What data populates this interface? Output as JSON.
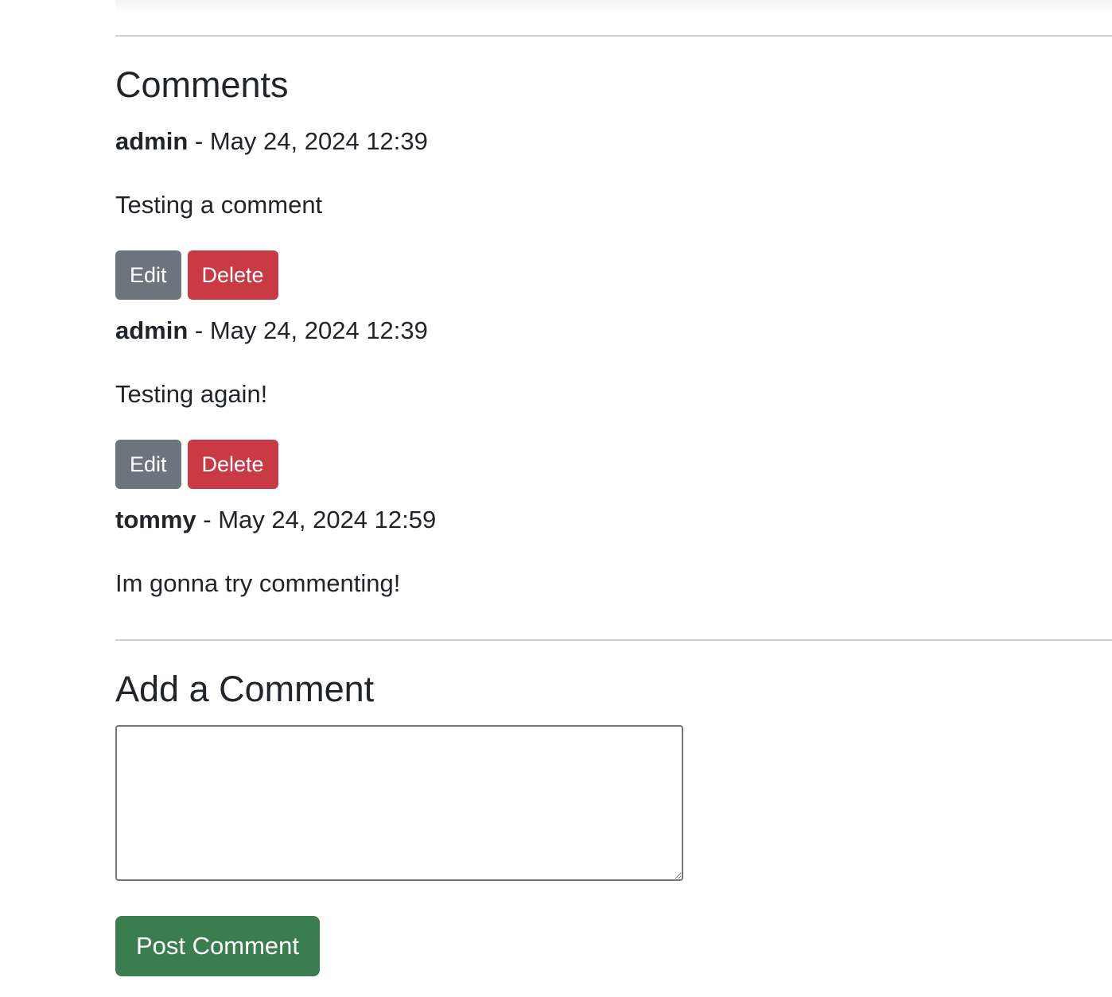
{
  "comments_section": {
    "heading": "Comments",
    "separator": " - ",
    "items": [
      {
        "author": "admin",
        "timestamp": "May 24, 2024 12:39",
        "text": "Testing a comment",
        "edit_label": "Edit",
        "delete_label": "Delete"
      },
      {
        "author": "admin",
        "timestamp": "May 24, 2024 12:39",
        "text": "Testing again!",
        "edit_label": "Edit",
        "delete_label": "Delete"
      },
      {
        "author": "tommy",
        "timestamp": "May 24, 2024 12:59",
        "text": "Im gonna try commenting!"
      }
    ]
  },
  "add_comment": {
    "heading": "Add a Comment",
    "textarea_value": "",
    "submit_label": "Post Comment"
  },
  "colors": {
    "edit_button": "#6c757d",
    "delete_button": "#c93a44",
    "post_button": "#3a7d4f"
  }
}
